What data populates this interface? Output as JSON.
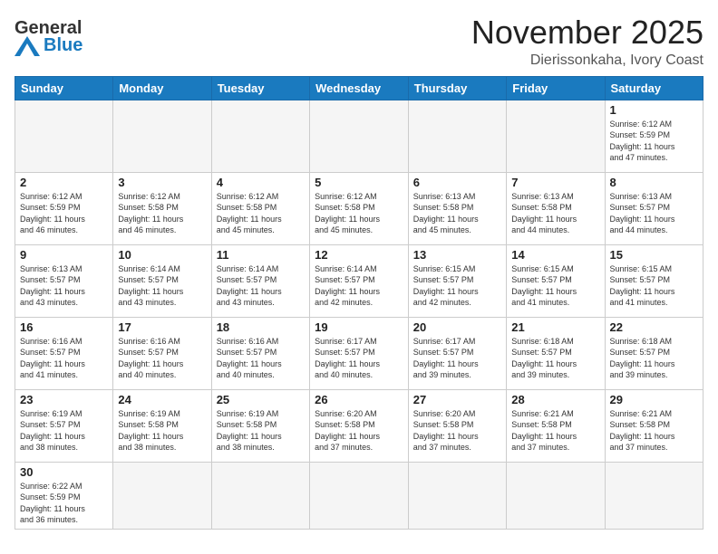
{
  "header": {
    "logo_line1": "General",
    "logo_line2": "Blue",
    "month": "November 2025",
    "location": "Dierissonkaha, Ivory Coast"
  },
  "days_of_week": [
    "Sunday",
    "Monday",
    "Tuesday",
    "Wednesday",
    "Thursday",
    "Friday",
    "Saturday"
  ],
  "weeks": [
    [
      {
        "day": "",
        "info": ""
      },
      {
        "day": "",
        "info": ""
      },
      {
        "day": "",
        "info": ""
      },
      {
        "day": "",
        "info": ""
      },
      {
        "day": "",
        "info": ""
      },
      {
        "day": "",
        "info": ""
      },
      {
        "day": "1",
        "info": "Sunrise: 6:12 AM\nSunset: 5:59 PM\nDaylight: 11 hours\nand 47 minutes."
      }
    ],
    [
      {
        "day": "2",
        "info": "Sunrise: 6:12 AM\nSunset: 5:59 PM\nDaylight: 11 hours\nand 46 minutes."
      },
      {
        "day": "3",
        "info": "Sunrise: 6:12 AM\nSunset: 5:58 PM\nDaylight: 11 hours\nand 46 minutes."
      },
      {
        "day": "4",
        "info": "Sunrise: 6:12 AM\nSunset: 5:58 PM\nDaylight: 11 hours\nand 45 minutes."
      },
      {
        "day": "5",
        "info": "Sunrise: 6:12 AM\nSunset: 5:58 PM\nDaylight: 11 hours\nand 45 minutes."
      },
      {
        "day": "6",
        "info": "Sunrise: 6:13 AM\nSunset: 5:58 PM\nDaylight: 11 hours\nand 45 minutes."
      },
      {
        "day": "7",
        "info": "Sunrise: 6:13 AM\nSunset: 5:58 PM\nDaylight: 11 hours\nand 44 minutes."
      },
      {
        "day": "8",
        "info": "Sunrise: 6:13 AM\nSunset: 5:57 PM\nDaylight: 11 hours\nand 44 minutes."
      }
    ],
    [
      {
        "day": "9",
        "info": "Sunrise: 6:13 AM\nSunset: 5:57 PM\nDaylight: 11 hours\nand 43 minutes."
      },
      {
        "day": "10",
        "info": "Sunrise: 6:14 AM\nSunset: 5:57 PM\nDaylight: 11 hours\nand 43 minutes."
      },
      {
        "day": "11",
        "info": "Sunrise: 6:14 AM\nSunset: 5:57 PM\nDaylight: 11 hours\nand 43 minutes."
      },
      {
        "day": "12",
        "info": "Sunrise: 6:14 AM\nSunset: 5:57 PM\nDaylight: 11 hours\nand 42 minutes."
      },
      {
        "day": "13",
        "info": "Sunrise: 6:15 AM\nSunset: 5:57 PM\nDaylight: 11 hours\nand 42 minutes."
      },
      {
        "day": "14",
        "info": "Sunrise: 6:15 AM\nSunset: 5:57 PM\nDaylight: 11 hours\nand 41 minutes."
      },
      {
        "day": "15",
        "info": "Sunrise: 6:15 AM\nSunset: 5:57 PM\nDaylight: 11 hours\nand 41 minutes."
      }
    ],
    [
      {
        "day": "16",
        "info": "Sunrise: 6:16 AM\nSunset: 5:57 PM\nDaylight: 11 hours\nand 41 minutes."
      },
      {
        "day": "17",
        "info": "Sunrise: 6:16 AM\nSunset: 5:57 PM\nDaylight: 11 hours\nand 40 minutes."
      },
      {
        "day": "18",
        "info": "Sunrise: 6:16 AM\nSunset: 5:57 PM\nDaylight: 11 hours\nand 40 minutes."
      },
      {
        "day": "19",
        "info": "Sunrise: 6:17 AM\nSunset: 5:57 PM\nDaylight: 11 hours\nand 40 minutes."
      },
      {
        "day": "20",
        "info": "Sunrise: 6:17 AM\nSunset: 5:57 PM\nDaylight: 11 hours\nand 39 minutes."
      },
      {
        "day": "21",
        "info": "Sunrise: 6:18 AM\nSunset: 5:57 PM\nDaylight: 11 hours\nand 39 minutes."
      },
      {
        "day": "22",
        "info": "Sunrise: 6:18 AM\nSunset: 5:57 PM\nDaylight: 11 hours\nand 39 minutes."
      }
    ],
    [
      {
        "day": "23",
        "info": "Sunrise: 6:19 AM\nSunset: 5:57 PM\nDaylight: 11 hours\nand 38 minutes."
      },
      {
        "day": "24",
        "info": "Sunrise: 6:19 AM\nSunset: 5:58 PM\nDaylight: 11 hours\nand 38 minutes."
      },
      {
        "day": "25",
        "info": "Sunrise: 6:19 AM\nSunset: 5:58 PM\nDaylight: 11 hours\nand 38 minutes."
      },
      {
        "day": "26",
        "info": "Sunrise: 6:20 AM\nSunset: 5:58 PM\nDaylight: 11 hours\nand 37 minutes."
      },
      {
        "day": "27",
        "info": "Sunrise: 6:20 AM\nSunset: 5:58 PM\nDaylight: 11 hours\nand 37 minutes."
      },
      {
        "day": "28",
        "info": "Sunrise: 6:21 AM\nSunset: 5:58 PM\nDaylight: 11 hours\nand 37 minutes."
      },
      {
        "day": "29",
        "info": "Sunrise: 6:21 AM\nSunset: 5:58 PM\nDaylight: 11 hours\nand 37 minutes."
      }
    ],
    [
      {
        "day": "30",
        "info": "Sunrise: 6:22 AM\nSunset: 5:59 PM\nDaylight: 11 hours\nand 36 minutes."
      },
      {
        "day": "",
        "info": ""
      },
      {
        "day": "",
        "info": ""
      },
      {
        "day": "",
        "info": ""
      },
      {
        "day": "",
        "info": ""
      },
      {
        "day": "",
        "info": ""
      },
      {
        "day": "",
        "info": ""
      }
    ]
  ]
}
